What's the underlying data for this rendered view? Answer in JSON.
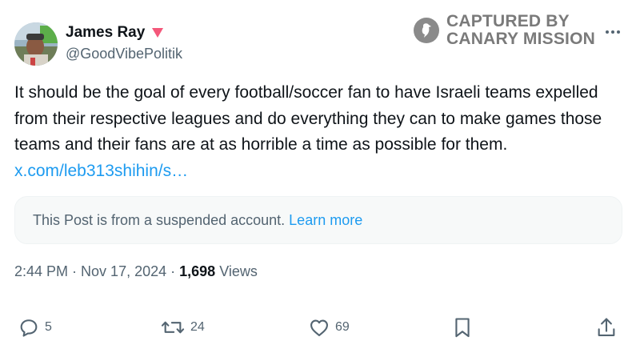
{
  "author": {
    "name": "James Ray",
    "handle": "@GoodVibePolitik",
    "badge_icon": "pink-triangle-icon",
    "badge_color": "#f4577a"
  },
  "watermark": {
    "line1": "CAPTURED BY",
    "line2": "CANARY MISSION",
    "icon": "canary-bird-icon"
  },
  "tweet": {
    "text": "It should be the goal of every football/soccer fan to have Israeli teams expelled from their respective leagues and do everything they can to make games those teams and their fans are at as horrible a time as possible for them.",
    "link": "x.com/leb313shihin/s…"
  },
  "notice": {
    "text": "This Post is from a suspended account.",
    "link": "Learn more"
  },
  "meta": {
    "time": "2:44 PM",
    "separator": " · ",
    "date": "Nov 17, 2024",
    "views_count": "1,698",
    "views_label": "Views"
  },
  "actions": {
    "replies": "5",
    "reposts": "24",
    "likes": "69"
  },
  "colors": {
    "link": "#1d9bf0",
    "secondary_text": "#536471",
    "primary_text": "#0f1419"
  }
}
